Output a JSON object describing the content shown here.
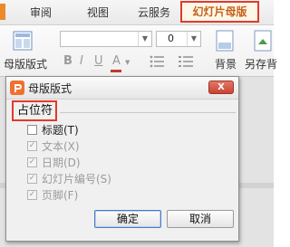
{
  "tabs": {
    "items": [
      "审阅",
      "视图",
      "云服务"
    ],
    "active": "幻灯片母版"
  },
  "ribbon": {
    "master_layout_label": "母版版式",
    "font_size_value": "0",
    "background_label": "背景",
    "save_as_label": "另存背",
    "format_buttons": [
      "B",
      "I",
      "U",
      "A"
    ]
  },
  "dialog": {
    "title": "母版版式",
    "close_label": "X",
    "group_label": "占位符",
    "checkboxes": [
      {
        "label": "标题(T)",
        "checked": false,
        "enabled": true
      },
      {
        "label": "文本(X)",
        "checked": true,
        "enabled": false
      },
      {
        "label": "日期(D)",
        "checked": true,
        "enabled": false
      },
      {
        "label": "幻灯片编号(S)",
        "checked": true,
        "enabled": false
      },
      {
        "label": "页脚(F)",
        "checked": true,
        "enabled": false
      }
    ],
    "ok_label": "确定",
    "cancel_label": "取消"
  },
  "colors": {
    "highlight": "#e23a2a",
    "active_tab_text": "#c8601a",
    "app_icon": "#f07030"
  }
}
